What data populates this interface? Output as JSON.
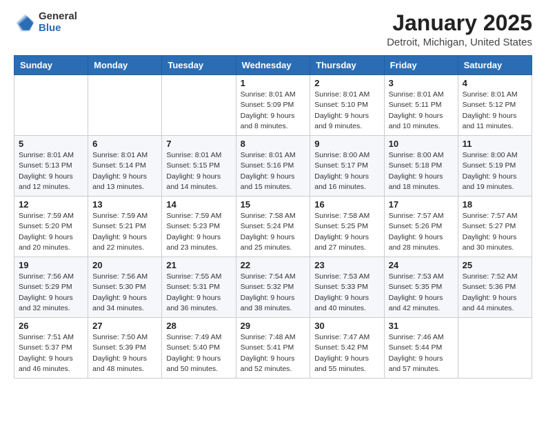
{
  "header": {
    "logo_general": "General",
    "logo_blue": "Blue",
    "title": "January 2025",
    "location": "Detroit, Michigan, United States"
  },
  "days_of_week": [
    "Sunday",
    "Monday",
    "Tuesday",
    "Wednesday",
    "Thursday",
    "Friday",
    "Saturday"
  ],
  "weeks": [
    [
      {
        "day": "",
        "info": ""
      },
      {
        "day": "",
        "info": ""
      },
      {
        "day": "",
        "info": ""
      },
      {
        "day": "1",
        "info": "Sunrise: 8:01 AM\nSunset: 5:09 PM\nDaylight: 9 hours\nand 8 minutes."
      },
      {
        "day": "2",
        "info": "Sunrise: 8:01 AM\nSunset: 5:10 PM\nDaylight: 9 hours\nand 9 minutes."
      },
      {
        "day": "3",
        "info": "Sunrise: 8:01 AM\nSunset: 5:11 PM\nDaylight: 9 hours\nand 10 minutes."
      },
      {
        "day": "4",
        "info": "Sunrise: 8:01 AM\nSunset: 5:12 PM\nDaylight: 9 hours\nand 11 minutes."
      }
    ],
    [
      {
        "day": "5",
        "info": "Sunrise: 8:01 AM\nSunset: 5:13 PM\nDaylight: 9 hours\nand 12 minutes."
      },
      {
        "day": "6",
        "info": "Sunrise: 8:01 AM\nSunset: 5:14 PM\nDaylight: 9 hours\nand 13 minutes."
      },
      {
        "day": "7",
        "info": "Sunrise: 8:01 AM\nSunset: 5:15 PM\nDaylight: 9 hours\nand 14 minutes."
      },
      {
        "day": "8",
        "info": "Sunrise: 8:01 AM\nSunset: 5:16 PM\nDaylight: 9 hours\nand 15 minutes."
      },
      {
        "day": "9",
        "info": "Sunrise: 8:00 AM\nSunset: 5:17 PM\nDaylight: 9 hours\nand 16 minutes."
      },
      {
        "day": "10",
        "info": "Sunrise: 8:00 AM\nSunset: 5:18 PM\nDaylight: 9 hours\nand 18 minutes."
      },
      {
        "day": "11",
        "info": "Sunrise: 8:00 AM\nSunset: 5:19 PM\nDaylight: 9 hours\nand 19 minutes."
      }
    ],
    [
      {
        "day": "12",
        "info": "Sunrise: 7:59 AM\nSunset: 5:20 PM\nDaylight: 9 hours\nand 20 minutes."
      },
      {
        "day": "13",
        "info": "Sunrise: 7:59 AM\nSunset: 5:21 PM\nDaylight: 9 hours\nand 22 minutes."
      },
      {
        "day": "14",
        "info": "Sunrise: 7:59 AM\nSunset: 5:23 PM\nDaylight: 9 hours\nand 23 minutes."
      },
      {
        "day": "15",
        "info": "Sunrise: 7:58 AM\nSunset: 5:24 PM\nDaylight: 9 hours\nand 25 minutes."
      },
      {
        "day": "16",
        "info": "Sunrise: 7:58 AM\nSunset: 5:25 PM\nDaylight: 9 hours\nand 27 minutes."
      },
      {
        "day": "17",
        "info": "Sunrise: 7:57 AM\nSunset: 5:26 PM\nDaylight: 9 hours\nand 28 minutes."
      },
      {
        "day": "18",
        "info": "Sunrise: 7:57 AM\nSunset: 5:27 PM\nDaylight: 9 hours\nand 30 minutes."
      }
    ],
    [
      {
        "day": "19",
        "info": "Sunrise: 7:56 AM\nSunset: 5:29 PM\nDaylight: 9 hours\nand 32 minutes."
      },
      {
        "day": "20",
        "info": "Sunrise: 7:56 AM\nSunset: 5:30 PM\nDaylight: 9 hours\nand 34 minutes."
      },
      {
        "day": "21",
        "info": "Sunrise: 7:55 AM\nSunset: 5:31 PM\nDaylight: 9 hours\nand 36 minutes."
      },
      {
        "day": "22",
        "info": "Sunrise: 7:54 AM\nSunset: 5:32 PM\nDaylight: 9 hours\nand 38 minutes."
      },
      {
        "day": "23",
        "info": "Sunrise: 7:53 AM\nSunset: 5:33 PM\nDaylight: 9 hours\nand 40 minutes."
      },
      {
        "day": "24",
        "info": "Sunrise: 7:53 AM\nSunset: 5:35 PM\nDaylight: 9 hours\nand 42 minutes."
      },
      {
        "day": "25",
        "info": "Sunrise: 7:52 AM\nSunset: 5:36 PM\nDaylight: 9 hours\nand 44 minutes."
      }
    ],
    [
      {
        "day": "26",
        "info": "Sunrise: 7:51 AM\nSunset: 5:37 PM\nDaylight: 9 hours\nand 46 minutes."
      },
      {
        "day": "27",
        "info": "Sunrise: 7:50 AM\nSunset: 5:39 PM\nDaylight: 9 hours\nand 48 minutes."
      },
      {
        "day": "28",
        "info": "Sunrise: 7:49 AM\nSunset: 5:40 PM\nDaylight: 9 hours\nand 50 minutes."
      },
      {
        "day": "29",
        "info": "Sunrise: 7:48 AM\nSunset: 5:41 PM\nDaylight: 9 hours\nand 52 minutes."
      },
      {
        "day": "30",
        "info": "Sunrise: 7:47 AM\nSunset: 5:42 PM\nDaylight: 9 hours\nand 55 minutes."
      },
      {
        "day": "31",
        "info": "Sunrise: 7:46 AM\nSunset: 5:44 PM\nDaylight: 9 hours\nand 57 minutes."
      },
      {
        "day": "",
        "info": ""
      }
    ]
  ]
}
